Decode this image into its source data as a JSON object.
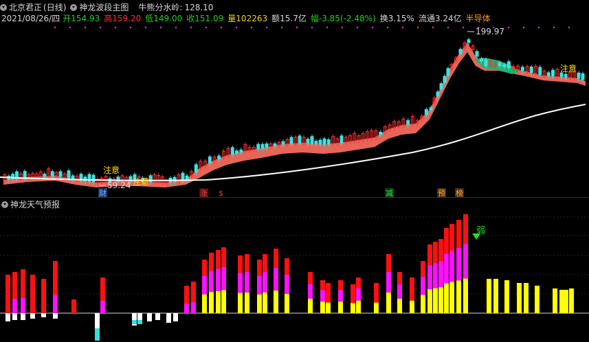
{
  "header": {
    "stock_name": "北京君正",
    "period": "(日线)",
    "indicator": "神龙波段主图",
    "cattle_label": "牛熊分水岭:",
    "cattle_value": "128.10"
  },
  "quote": {
    "date": "2021/08/26/四",
    "open_label": "开",
    "open": "154.93",
    "high_label": "高",
    "high": "159.20",
    "low_label": "低",
    "low": "149.00",
    "close_label": "收",
    "close": "151.09",
    "volume_label": "量",
    "volume": "102263",
    "amount_label": "额",
    "amount": "15.7亿",
    "change_label": "幅",
    "change": "-3.85(-2.48%)",
    "turnover_label": "换",
    "turnover": "3.15%",
    "float_label": "流通",
    "float": "3.24亿",
    "sector": "半导体"
  },
  "annotations": {
    "max_price": "199.97",
    "min_price": "59.24",
    "attention": "注意",
    "weak": "弱",
    "tags": [
      "财",
      "涨",
      "$",
      "减",
      "预",
      "榜"
    ]
  },
  "lower_panel": {
    "title": "神龙天气预报"
  },
  "colors": {
    "up": "#ff3030",
    "down": "#40e0e0",
    "band_up": "#ff7060",
    "band_down": "#20b070",
    "ma": "#ffffff",
    "bar_red": "#ff1010",
    "bar_magenta": "#ff10ff",
    "bar_yellow": "#ffff00"
  }
}
